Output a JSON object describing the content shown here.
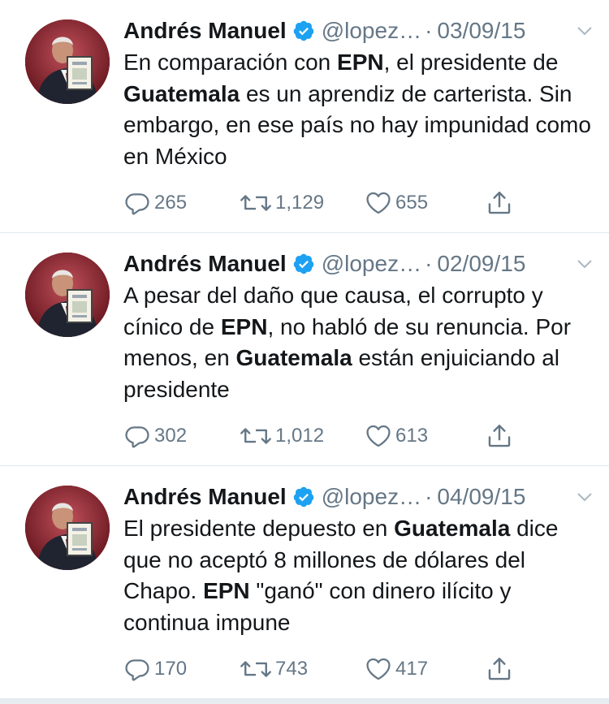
{
  "colors": {
    "verified_blue": "#1da1f2",
    "secondary_text": "#657786",
    "divider": "#e1e8ed"
  },
  "icons": {
    "verified": "verified-badge-icon",
    "menu": "chevron-down-icon",
    "reply": "reply-icon",
    "retweet": "retweet-icon",
    "like": "heart-icon",
    "share": "share-icon"
  },
  "tweets": [
    {
      "author_name": "Andrés Manuel",
      "handle": "@lopez…",
      "separator": "·",
      "date": "03/09/15",
      "text": [
        {
          "t": "En comparación con ",
          "b": false
        },
        {
          "t": "EPN",
          "b": true
        },
        {
          "t": ", el presidente de ",
          "b": false
        },
        {
          "t": "Guatemala",
          "b": true
        },
        {
          "t": " es un aprendiz de carterista. Sin embargo, en ese país no hay impunidad como en México",
          "b": false
        }
      ],
      "replies": "265",
      "retweets": "1,129",
      "likes": "655"
    },
    {
      "author_name": "Andrés Manuel",
      "handle": "@lopez…",
      "separator": "·",
      "date": "02/09/15",
      "text": [
        {
          "t": "A pesar del daño que causa, el corrupto y cínico de ",
          "b": false
        },
        {
          "t": "EPN",
          "b": true
        },
        {
          "t": ", no habló de su renuncia. Por menos, en ",
          "b": false
        },
        {
          "t": "Guatemala",
          "b": true
        },
        {
          "t": " están enjuiciando al presidente",
          "b": false
        }
      ],
      "replies": "302",
      "retweets": "1,012",
      "likes": "613"
    },
    {
      "author_name": "Andrés Manuel",
      "handle": "@lopez…",
      "separator": "·",
      "date": "04/09/15",
      "text": [
        {
          "t": "El presidente depuesto en ",
          "b": false
        },
        {
          "t": "Guatemala",
          "b": true
        },
        {
          "t": " dice que no aceptó 8 millones de dólares del Chapo. ",
          "b": false
        },
        {
          "t": "EPN",
          "b": true
        },
        {
          "t": " \"ganó\" con dinero ilícito y continua impune",
          "b": false
        }
      ],
      "replies": "170",
      "retweets": "743",
      "likes": "417"
    }
  ]
}
